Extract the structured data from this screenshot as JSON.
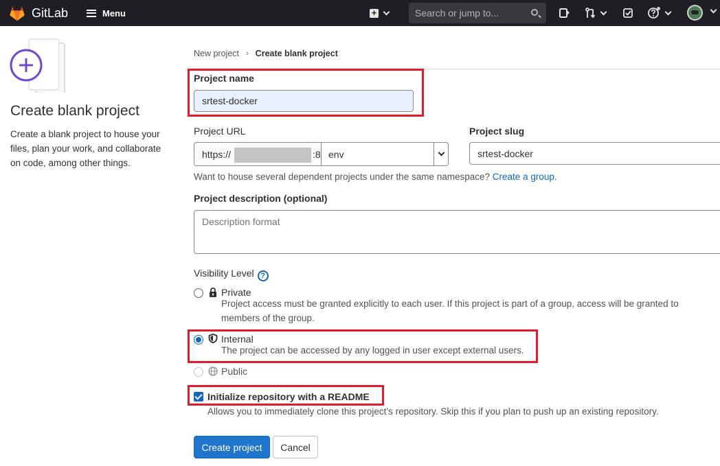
{
  "topbar": {
    "brand": "GitLab",
    "menu_label": "Menu",
    "search_placeholder": "Search or jump to..."
  },
  "left_panel": {
    "title": "Create blank project",
    "description": "Create a blank project to house your files, plan your work, and collaborate on code, among other things."
  },
  "breadcrumb": {
    "parent": "New project",
    "current": "Create blank project"
  },
  "form": {
    "project_name_label": "Project name",
    "project_name_value": "srtest-docker",
    "project_url_label": "Project URL",
    "url_prefix": "https://",
    "url_port_fragment": ":8",
    "namespace_value": "env",
    "project_slug_label": "Project slug",
    "project_slug_value": "srtest-docker",
    "namespace_hint": "Want to house several dependent projects under the same namespace?",
    "create_group_link": "Create a group.",
    "description_label": "Project description (optional)",
    "description_placeholder": "Description format",
    "visibility_label": "Visibility Level",
    "visibility": {
      "selected": "internal",
      "private_title": "Private",
      "private_desc": "Project access must be granted explicitly to each user. If this project is part of a group, access will be granted to members of the group.",
      "internal_title": "Internal",
      "internal_desc": "The project can be accessed by any logged in user except external users.",
      "public_title": "Public"
    },
    "readme_checked": true,
    "readme_label": "Initialize repository with a README",
    "readme_desc": "Allows you to immediately clone this project’s repository. Skip this if you plan to push up an existing repository.",
    "create_button": "Create project",
    "cancel_button": "Cancel"
  },
  "colors": {
    "topbar": "#1f1e24",
    "primary": "#1f75cb",
    "link": "#1068bf",
    "highlight": "#e31a2a",
    "name_input_bg": "#e8f0fe"
  },
  "icons": [
    "gitlab-logo-icon",
    "menu-icon",
    "plus-icon",
    "search-icon",
    "issues-icon",
    "merge-request-icon",
    "todo-icon",
    "help-icon",
    "lock-icon",
    "shield-icon",
    "globe-icon"
  ]
}
